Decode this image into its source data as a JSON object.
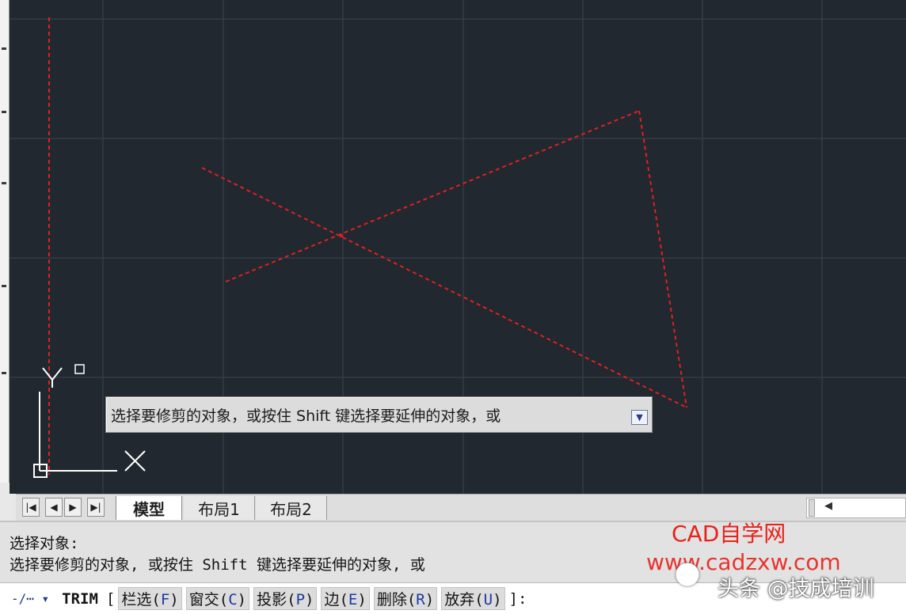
{
  "drawing": {
    "tooltip_text": "选择要修剪的对象，或按住 Shift 键选择要延伸的对象，或",
    "ucs_y_label": "Y",
    "ucs_x_label": "X"
  },
  "tabs": {
    "nav_first": "|◀",
    "nav_prev": "◀",
    "nav_next": "▶",
    "nav_last": "▶|",
    "items": [
      {
        "label": "模型"
      },
      {
        "label": "布局1"
      },
      {
        "label": "布局2"
      }
    ],
    "scroll_left": "◀"
  },
  "command_history": {
    "line1": "选择对象:",
    "line2": "选择要修剪的对象, 或按住 Shift 键选择要延伸的对象, 或"
  },
  "command_line": {
    "icon": "-/⋯ ▾",
    "command": "TRIM",
    "open_bracket": "[",
    "options": [
      {
        "label": "栏选(",
        "key": "F",
        "close": ")"
      },
      {
        "label": "窗交(",
        "key": "C",
        "close": ")"
      },
      {
        "label": "投影(",
        "key": "P",
        "close": ")"
      },
      {
        "label": "边(",
        "key": "E",
        "close": ")"
      },
      {
        "label": "删除(",
        "key": "R",
        "close": ")"
      },
      {
        "label": "放弃(",
        "key": "U",
        "close": ")"
      }
    ],
    "close_bracket": "]:"
  },
  "watermark": {
    "site_name": "CAD自学网",
    "url": "www.cadzxw.com",
    "author": "头条 @技成培训"
  },
  "colors": {
    "canvas_bg": "#212830",
    "grid": "#3a4350",
    "selected_lines": "#e02020",
    "ucs_icon": "#ffffff"
  }
}
